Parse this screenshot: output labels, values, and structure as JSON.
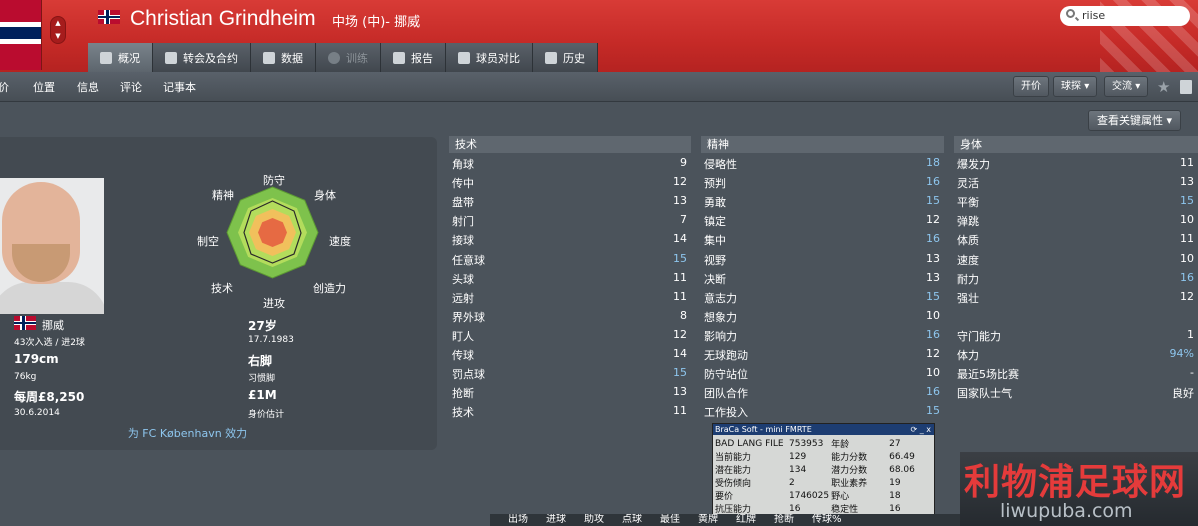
{
  "header": {
    "name": "Christian Grindheim",
    "position": "中场 (中)- 挪威",
    "search": "riise",
    "colors": {
      "accent": "#c8302c",
      "value_highlight": "#8ec6ee"
    }
  },
  "tabs": [
    {
      "label": "概况",
      "icon": "overview-icon"
    },
    {
      "label": "转会及合约",
      "icon": "contract-icon"
    },
    {
      "label": "数据",
      "icon": "stats-icon"
    },
    {
      "label": "训练",
      "icon": "training-icon"
    },
    {
      "label": "报告",
      "icon": "report-icon"
    },
    {
      "label": "球员对比",
      "icon": "compare-icon"
    },
    {
      "label": "历史",
      "icon": "history-icon"
    }
  ],
  "subnav": [
    "价",
    "位置",
    "信息",
    "评论",
    "记事本"
  ],
  "actions": {
    "value": "开价",
    "scout": "球探",
    "interact": "交流",
    "key_attrs": "查看关键属性"
  },
  "radar": {
    "labels": [
      "防守",
      "身体",
      "速度",
      "创造力",
      "进攻",
      "技术",
      "制空",
      "精神"
    ]
  },
  "profile": {
    "nationality": "挪威",
    "caps": "43次入选 / 进2球",
    "height": "179cm",
    "weight": "76kg",
    "wage": "每周£8,250",
    "contract_end": "30.6.2014",
    "age": "27岁",
    "dob": "17.7.1983",
    "foot": "右脚",
    "foot_label": "习惯脚",
    "value": "£1M",
    "value_label": "身价估计",
    "club": "为 FC København 效力"
  },
  "technical": {
    "title": "技术",
    "rows": [
      {
        "name": "角球",
        "value": "9"
      },
      {
        "name": "传中",
        "value": "12"
      },
      {
        "name": "盘带",
        "value": "13"
      },
      {
        "name": "射门",
        "value": "7"
      },
      {
        "name": "接球",
        "value": "14"
      },
      {
        "name": "任意球",
        "value": "15"
      },
      {
        "name": "头球",
        "value": "11"
      },
      {
        "name": "远射",
        "value": "11"
      },
      {
        "name": "界外球",
        "value": "8"
      },
      {
        "name": "盯人",
        "value": "12"
      },
      {
        "name": "传球",
        "value": "14"
      },
      {
        "name": "罚点球",
        "value": "15"
      },
      {
        "name": "抢断",
        "value": "13"
      },
      {
        "name": "技术",
        "value": "11"
      }
    ]
  },
  "mental": {
    "title": "精神",
    "rows": [
      {
        "name": "侵略性",
        "value": "18"
      },
      {
        "name": "预判",
        "value": "16"
      },
      {
        "name": "勇敢",
        "value": "15"
      },
      {
        "name": "镇定",
        "value": "12"
      },
      {
        "name": "集中",
        "value": "16"
      },
      {
        "name": "视野",
        "value": "13"
      },
      {
        "name": "决断",
        "value": "13"
      },
      {
        "name": "意志力",
        "value": "15"
      },
      {
        "name": "想象力",
        "value": "10"
      },
      {
        "name": "影响力",
        "value": "16"
      },
      {
        "name": "无球跑动",
        "value": "12"
      },
      {
        "name": "防守站位",
        "value": "10"
      },
      {
        "name": "团队合作",
        "value": "16"
      },
      {
        "name": "工作投入",
        "value": "15"
      }
    ]
  },
  "physical": {
    "title": "身体",
    "rows": [
      {
        "name": "爆发力",
        "value": "11"
      },
      {
        "name": "灵活",
        "value": "13"
      },
      {
        "name": "平衡",
        "value": "15"
      },
      {
        "name": "弹跳",
        "value": "10"
      },
      {
        "name": "体质",
        "value": "11"
      },
      {
        "name": "速度",
        "value": "10"
      },
      {
        "name": "耐力",
        "value": "16"
      },
      {
        "name": "强壮",
        "value": "12"
      }
    ],
    "extra": [
      {
        "name": "守门能力",
        "value": "1"
      },
      {
        "name": "体力",
        "value": "94%"
      },
      {
        "name": "最近5场比赛",
        "value": "-"
      },
      {
        "name": "国家队士气",
        "value": "良好"
      }
    ]
  },
  "fmrte": {
    "title": "BraCa Soft - mini FMRTE",
    "rows": [
      [
        "BAD LANG FILE",
        "753953",
        "年龄",
        "27"
      ],
      [
        "当前能力",
        "129",
        "能力分数",
        "66.49"
      ],
      [
        "潜在能力",
        "134",
        "潜力分数",
        "68.06"
      ],
      [
        "受伤倾向",
        "2",
        "职业素养",
        "19"
      ],
      [
        "要价",
        "1746025",
        "野心",
        "18"
      ],
      [
        "抗压能力",
        "16",
        "稳定性",
        "16"
      ]
    ]
  },
  "watermark": {
    "line1": "利物浦足球网",
    "line2": "liwupuba.com"
  },
  "bottom_tabs": [
    "出场",
    "进球",
    "助攻",
    "点球",
    "最佳",
    "黄牌",
    "红牌",
    "抢断",
    "传球%"
  ]
}
